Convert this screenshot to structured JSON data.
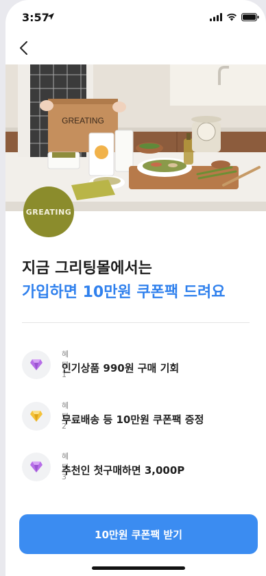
{
  "status_bar": {
    "time": "3:57"
  },
  "hero": {
    "box_brand": "GREATING"
  },
  "logo": {
    "text": "GREATING"
  },
  "headline": {
    "line1": "지금 그리팅몰에서는",
    "line2": "가입하면 10만원 쿠폰팩 드려요",
    "accent_color": "#2f80ed"
  },
  "benefits": [
    {
      "tag": "혜택1",
      "text": "인기상품 990원 구매 기회",
      "icon": "purple-gem-icon",
      "color": "#b76ee8"
    },
    {
      "tag": "혜택2",
      "text": "무료배송 등 10만원 쿠폰팩 증정",
      "icon": "gold-gem-icon",
      "color": "#f4c23a"
    },
    {
      "tag": "혜택3",
      "text": "추천인 첫구매하면 3,000P",
      "icon": "purple-gem-icon",
      "color": "#b76ee8"
    }
  ],
  "cta": {
    "label": "10만원 쿠폰팩 받기",
    "color": "#3b8cf1"
  }
}
